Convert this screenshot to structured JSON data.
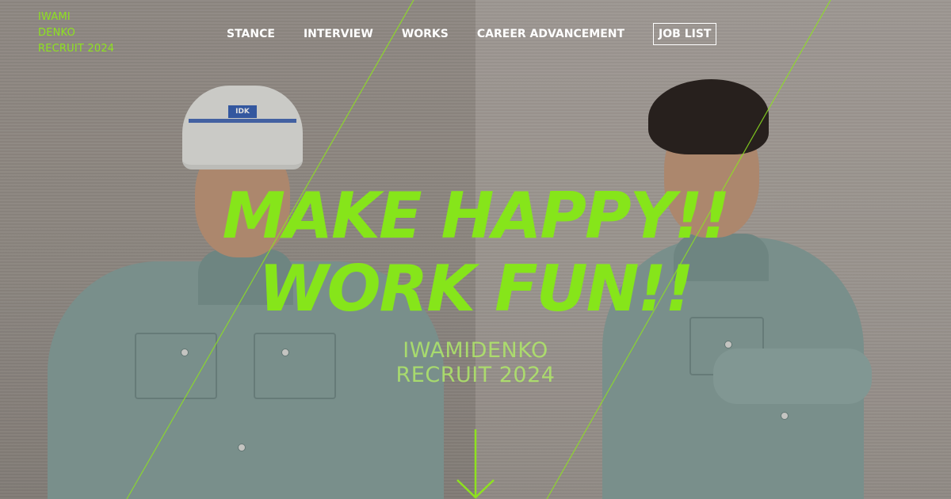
{
  "header": {
    "logo_lines": [
      "IWAMI",
      "DENKO",
      "RECRUIT 2024"
    ]
  },
  "nav": {
    "items": [
      "STANCE",
      "INTERVIEW",
      "WORKS",
      "CAREER ADVANCEMENT"
    ],
    "job_list_label": "JOB LIST"
  },
  "hero": {
    "headline_line1": "MAKE HAPPY!!",
    "headline_line2": "WORK FUN!!",
    "subtitle_line1": "IWAMIDENKO",
    "subtitle_line2": "RECRUIT 2024",
    "helmet_badge": "IDK"
  },
  "icons": {
    "scroll": "arrow-down-icon"
  },
  "colors": {
    "accent": "#86e51a",
    "nav_text": "#ffffff"
  }
}
